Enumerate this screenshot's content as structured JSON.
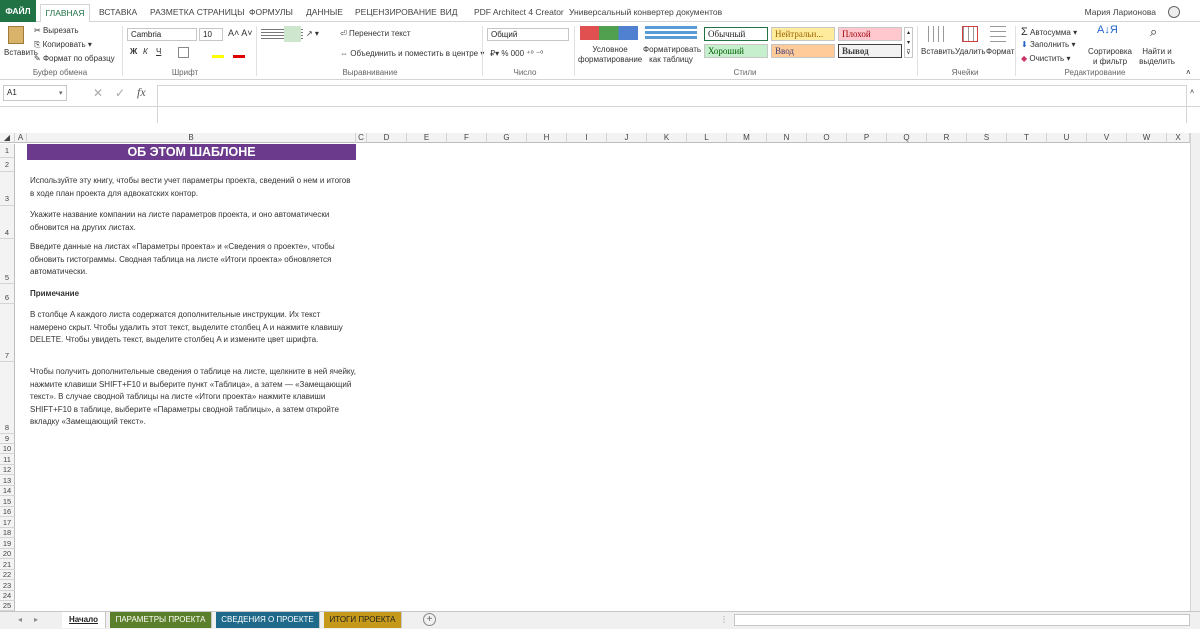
{
  "tabs": [
    "ФАЙЛ",
    "ГЛАВНАЯ",
    "ВСТАВКА",
    "РАЗМЕТКА СТРАНИЦЫ",
    "ФОРМУЛЫ",
    "ДАННЫЕ",
    "РЕЦЕНЗИРОВАНИЕ",
    "ВИД",
    "PDF Architect 4 Creator",
    "Универсальный конвертер документов"
  ],
  "user": "Мария Ларионова",
  "clipboard": {
    "paste": "Вставить",
    "cut": "Вырезать",
    "copy": "Копировать",
    "format": "Формат по образцу",
    "label": "Буфер обмена"
  },
  "font": {
    "name": "Cambria",
    "size": "10",
    "bold": "Ж",
    "italic": "К",
    "underline": "Ч",
    "label": "Шрифт"
  },
  "align": {
    "wrap": "Перенести текст",
    "merge": "Объединить и поместить в центре",
    "label": "Выравнивание"
  },
  "number": {
    "format": "Общий",
    "label": "Число"
  },
  "styles": {
    "conditional": "Условное форматирование",
    "astable": "Форматировать как таблицу",
    "normal": "Обычный",
    "neutral": "Нейтральн...",
    "bad": "Плохой",
    "good": "Хороший",
    "input": "Ввод",
    "output": "Вывод",
    "label": "Стили",
    "colors": {
      "neutral_bg": "#ffeb9c",
      "neutral_fg": "#9c6500",
      "bad_bg": "#ffc7ce",
      "bad_fg": "#9c0006",
      "good_bg": "#c6efce",
      "good_fg": "#006100",
      "input_bg": "#ffcc99",
      "input_fg": "#3f3f76",
      "output_bg": "#f2f2f2",
      "output_fg": "#3f3f3f"
    }
  },
  "cells": {
    "insert": "Вставить",
    "delete": "Удалить",
    "format": "Формат",
    "label": "Ячейки"
  },
  "editing": {
    "autosum": "Автосумма",
    "fill": "Заполнить",
    "clear": "Очистить",
    "sort": "Сортировка и фильтр",
    "find": "Найти и выделить",
    "label": "Редактирование"
  },
  "namebox": "A1",
  "fx": "fx",
  "columns": [
    "A",
    "B",
    "C",
    "D",
    "E",
    "F",
    "G",
    "H",
    "I",
    "J",
    "K",
    "L",
    "M",
    "N",
    "O",
    "P",
    "Q",
    "R",
    "S",
    "T",
    "U",
    "V",
    "W",
    "X"
  ],
  "rows": [
    "1",
    "2",
    "3",
    "4",
    "5",
    "6",
    "7",
    "8",
    "9",
    "10",
    "11",
    "12",
    "13",
    "14",
    "15",
    "16",
    "17",
    "18",
    "19",
    "20",
    "21",
    "22",
    "23",
    "24",
    "25"
  ],
  "content": {
    "title": "ОБ ЭТОМ ШАБЛОНЕ",
    "p1": "Используйте эту книгу, чтобы вести учет параметры проекта, сведений о нем и итогов в ходе план проекта для адвокатских контор.",
    "p2": "Укажите название компании на листе параметров проекта, и оно автоматически обновится на других листах.",
    "p3": "Введите данные на листах «Параметры проекта» и «Сведения о проекте», чтобы обновить гистограммы. Сводная таблица на листе «Итоги проекта» обновляется автоматически.",
    "note": "Примечание",
    "p4": "В столбце A каждого листа содержатся дополнительные инструкции. Их текст намерено скрыт. Чтобы удалить этот текст, выделите столбец A и нажмите клавишу DELETE. Чтобы увидеть текст, выделите столбец A и измените цвет шрифта.",
    "p5": "Чтобы получить дополнительные сведения о таблице на листе, щелкните в ней ячейку, нажмите клавиши SHIFT+F10 и выберите пункт «Таблица», а затем — «Замещающий текст». В случае сводной таблицы на листе «Итоги проекта» нажмите клавиши SHIFT+F10 в таблице, выберите «Параметры сводной таблицы», а затем откройте вкладку «Замещающий текст».",
    "title_bg": "#6b3a8c"
  },
  "sheets": [
    {
      "name": "Начало",
      "bg": "#ffffff",
      "fg": "#222222"
    },
    {
      "name": "ПАРАМЕТРЫ ПРОЕКТА",
      "bg": "#5b7f2a",
      "fg": "#ffffff"
    },
    {
      "name": "СВЕДЕНИЯ О ПРОЕКТЕ",
      "bg": "#1f6a8a",
      "fg": "#ffffff"
    },
    {
      "name": "ИТОГИ ПРОЕКТА",
      "bg": "#c59a1a",
      "fg": "#222222"
    }
  ]
}
